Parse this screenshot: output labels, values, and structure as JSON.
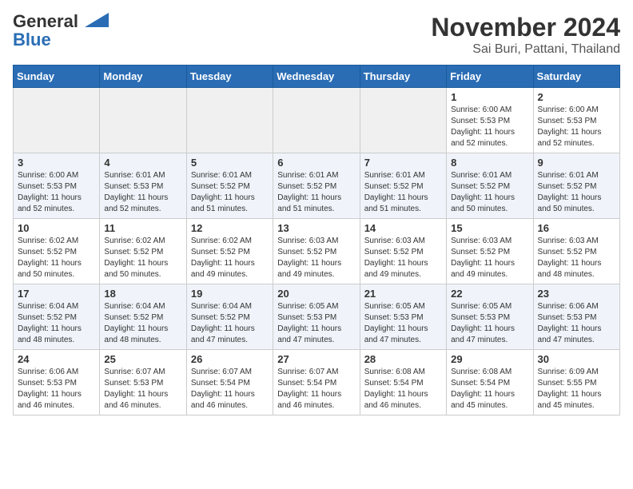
{
  "header": {
    "logo_general": "General",
    "logo_blue": "Blue",
    "month_title": "November 2024",
    "location": "Sai Buri, Pattani, Thailand"
  },
  "weekdays": [
    "Sunday",
    "Monday",
    "Tuesday",
    "Wednesday",
    "Thursday",
    "Friday",
    "Saturday"
  ],
  "weeks": [
    [
      {
        "day": "",
        "empty": true
      },
      {
        "day": "",
        "empty": true
      },
      {
        "day": "",
        "empty": true
      },
      {
        "day": "",
        "empty": true
      },
      {
        "day": "",
        "empty": true
      },
      {
        "day": "1",
        "sunrise": "6:00 AM",
        "sunset": "5:53 PM",
        "daylight": "11 hours and 52 minutes."
      },
      {
        "day": "2",
        "sunrise": "6:00 AM",
        "sunset": "5:53 PM",
        "daylight": "11 hours and 52 minutes."
      }
    ],
    [
      {
        "day": "3",
        "sunrise": "6:00 AM",
        "sunset": "5:53 PM",
        "daylight": "11 hours and 52 minutes."
      },
      {
        "day": "4",
        "sunrise": "6:01 AM",
        "sunset": "5:53 PM",
        "daylight": "11 hours and 52 minutes."
      },
      {
        "day": "5",
        "sunrise": "6:01 AM",
        "sunset": "5:52 PM",
        "daylight": "11 hours and 51 minutes."
      },
      {
        "day": "6",
        "sunrise": "6:01 AM",
        "sunset": "5:52 PM",
        "daylight": "11 hours and 51 minutes."
      },
      {
        "day": "7",
        "sunrise": "6:01 AM",
        "sunset": "5:52 PM",
        "daylight": "11 hours and 51 minutes."
      },
      {
        "day": "8",
        "sunrise": "6:01 AM",
        "sunset": "5:52 PM",
        "daylight": "11 hours and 50 minutes."
      },
      {
        "day": "9",
        "sunrise": "6:01 AM",
        "sunset": "5:52 PM",
        "daylight": "11 hours and 50 minutes."
      }
    ],
    [
      {
        "day": "10",
        "sunrise": "6:02 AM",
        "sunset": "5:52 PM",
        "daylight": "11 hours and 50 minutes."
      },
      {
        "day": "11",
        "sunrise": "6:02 AM",
        "sunset": "5:52 PM",
        "daylight": "11 hours and 50 minutes."
      },
      {
        "day": "12",
        "sunrise": "6:02 AM",
        "sunset": "5:52 PM",
        "daylight": "11 hours and 49 minutes."
      },
      {
        "day": "13",
        "sunrise": "6:03 AM",
        "sunset": "5:52 PM",
        "daylight": "11 hours and 49 minutes."
      },
      {
        "day": "14",
        "sunrise": "6:03 AM",
        "sunset": "5:52 PM",
        "daylight": "11 hours and 49 minutes."
      },
      {
        "day": "15",
        "sunrise": "6:03 AM",
        "sunset": "5:52 PM",
        "daylight": "11 hours and 49 minutes."
      },
      {
        "day": "16",
        "sunrise": "6:03 AM",
        "sunset": "5:52 PM",
        "daylight": "11 hours and 48 minutes."
      }
    ],
    [
      {
        "day": "17",
        "sunrise": "6:04 AM",
        "sunset": "5:52 PM",
        "daylight": "11 hours and 48 minutes."
      },
      {
        "day": "18",
        "sunrise": "6:04 AM",
        "sunset": "5:52 PM",
        "daylight": "11 hours and 48 minutes."
      },
      {
        "day": "19",
        "sunrise": "6:04 AM",
        "sunset": "5:52 PM",
        "daylight": "11 hours and 47 minutes."
      },
      {
        "day": "20",
        "sunrise": "6:05 AM",
        "sunset": "5:53 PM",
        "daylight": "11 hours and 47 minutes."
      },
      {
        "day": "21",
        "sunrise": "6:05 AM",
        "sunset": "5:53 PM",
        "daylight": "11 hours and 47 minutes."
      },
      {
        "day": "22",
        "sunrise": "6:05 AM",
        "sunset": "5:53 PM",
        "daylight": "11 hours and 47 minutes."
      },
      {
        "day": "23",
        "sunrise": "6:06 AM",
        "sunset": "5:53 PM",
        "daylight": "11 hours and 47 minutes."
      }
    ],
    [
      {
        "day": "24",
        "sunrise": "6:06 AM",
        "sunset": "5:53 PM",
        "daylight": "11 hours and 46 minutes."
      },
      {
        "day": "25",
        "sunrise": "6:07 AM",
        "sunset": "5:53 PM",
        "daylight": "11 hours and 46 minutes."
      },
      {
        "day": "26",
        "sunrise": "6:07 AM",
        "sunset": "5:54 PM",
        "daylight": "11 hours and 46 minutes."
      },
      {
        "day": "27",
        "sunrise": "6:07 AM",
        "sunset": "5:54 PM",
        "daylight": "11 hours and 46 minutes."
      },
      {
        "day": "28",
        "sunrise": "6:08 AM",
        "sunset": "5:54 PM",
        "daylight": "11 hours and 46 minutes."
      },
      {
        "day": "29",
        "sunrise": "6:08 AM",
        "sunset": "5:54 PM",
        "daylight": "11 hours and 45 minutes."
      },
      {
        "day": "30",
        "sunrise": "6:09 AM",
        "sunset": "5:55 PM",
        "daylight": "11 hours and 45 minutes."
      }
    ]
  ],
  "labels": {
    "sunrise": "Sunrise:",
    "sunset": "Sunset:",
    "daylight": "Daylight:"
  }
}
